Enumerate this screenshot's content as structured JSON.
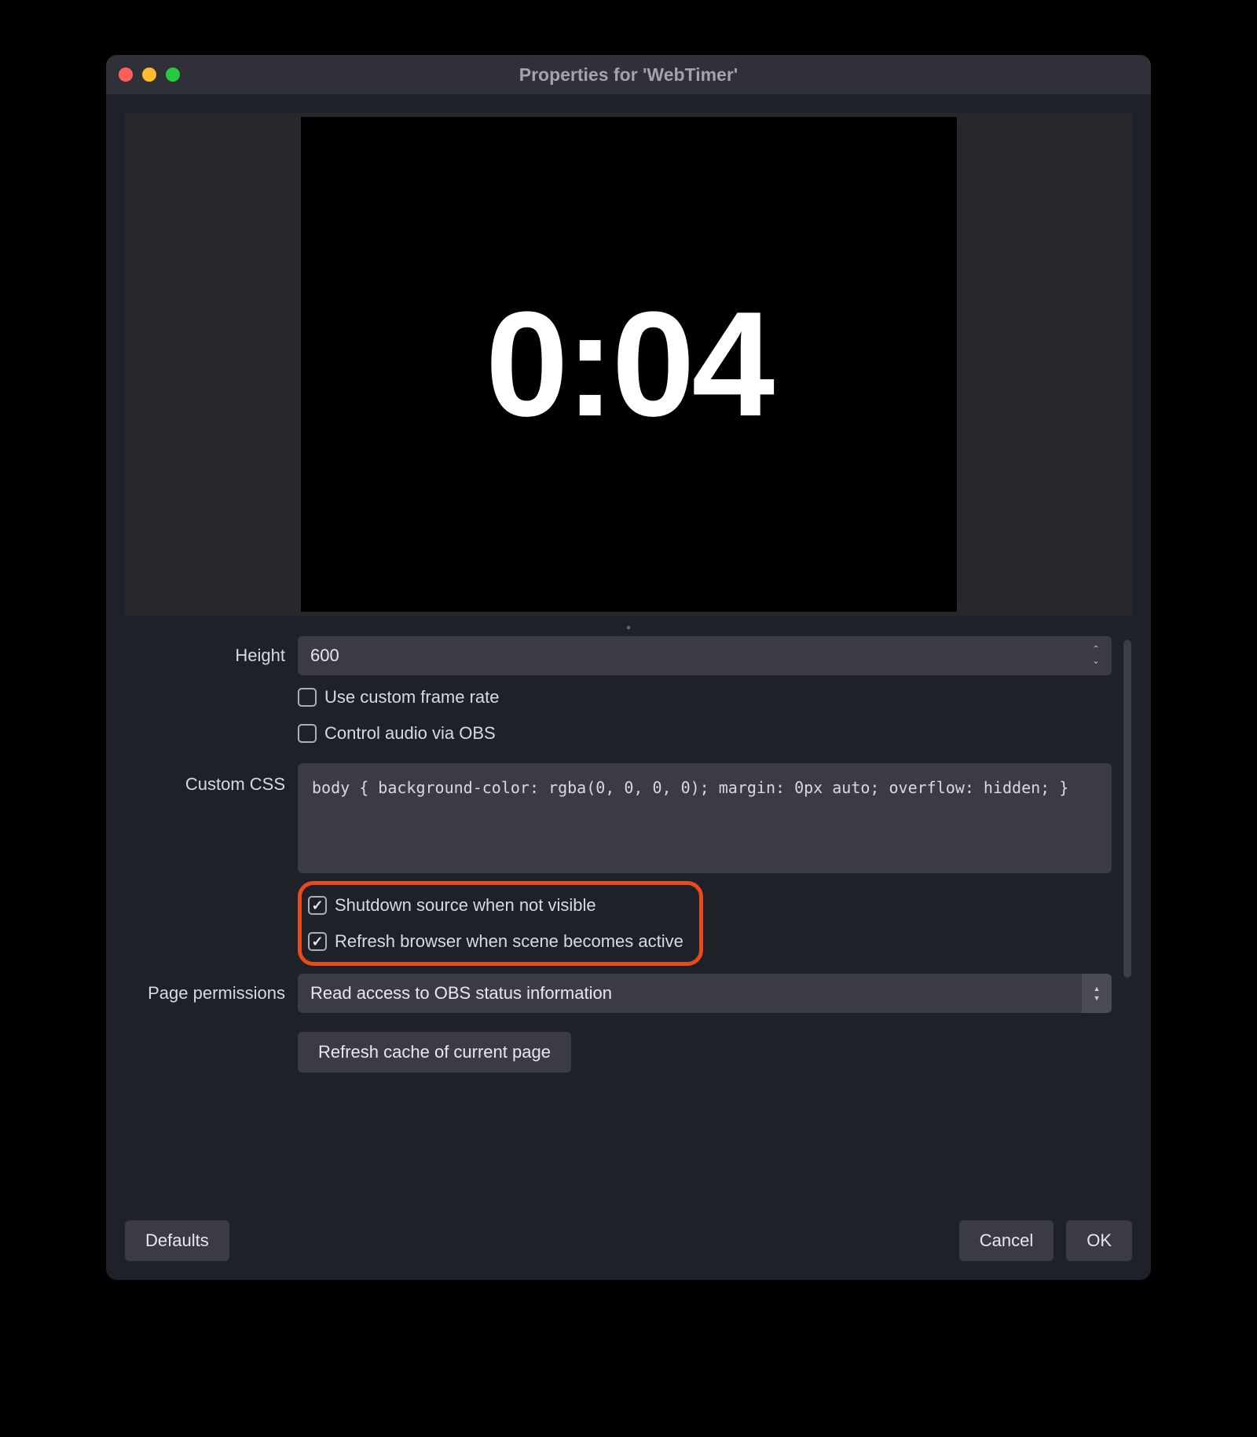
{
  "window": {
    "title": "Properties for 'WebTimer'"
  },
  "preview": {
    "timer": "0:04"
  },
  "form": {
    "height": {
      "label": "Height",
      "value": "600"
    },
    "useCustomFrameRate": {
      "label": "Use custom frame rate",
      "checked": false
    },
    "controlAudio": {
      "label": "Control audio via OBS",
      "checked": false
    },
    "customCss": {
      "label": "Custom CSS",
      "value": "body { background-color: rgba(0, 0, 0, 0); margin: 0px auto; overflow: hidden; }"
    },
    "shutdownSource": {
      "label": "Shutdown source when not visible",
      "checked": true
    },
    "refreshBrowser": {
      "label": "Refresh browser when scene becomes active",
      "checked": true
    },
    "pagePermissions": {
      "label": "Page permissions",
      "selected": "Read access to OBS status information"
    },
    "refreshCacheButton": "Refresh cache of current page"
  },
  "footer": {
    "defaults": "Defaults",
    "cancel": "Cancel",
    "ok": "OK"
  }
}
